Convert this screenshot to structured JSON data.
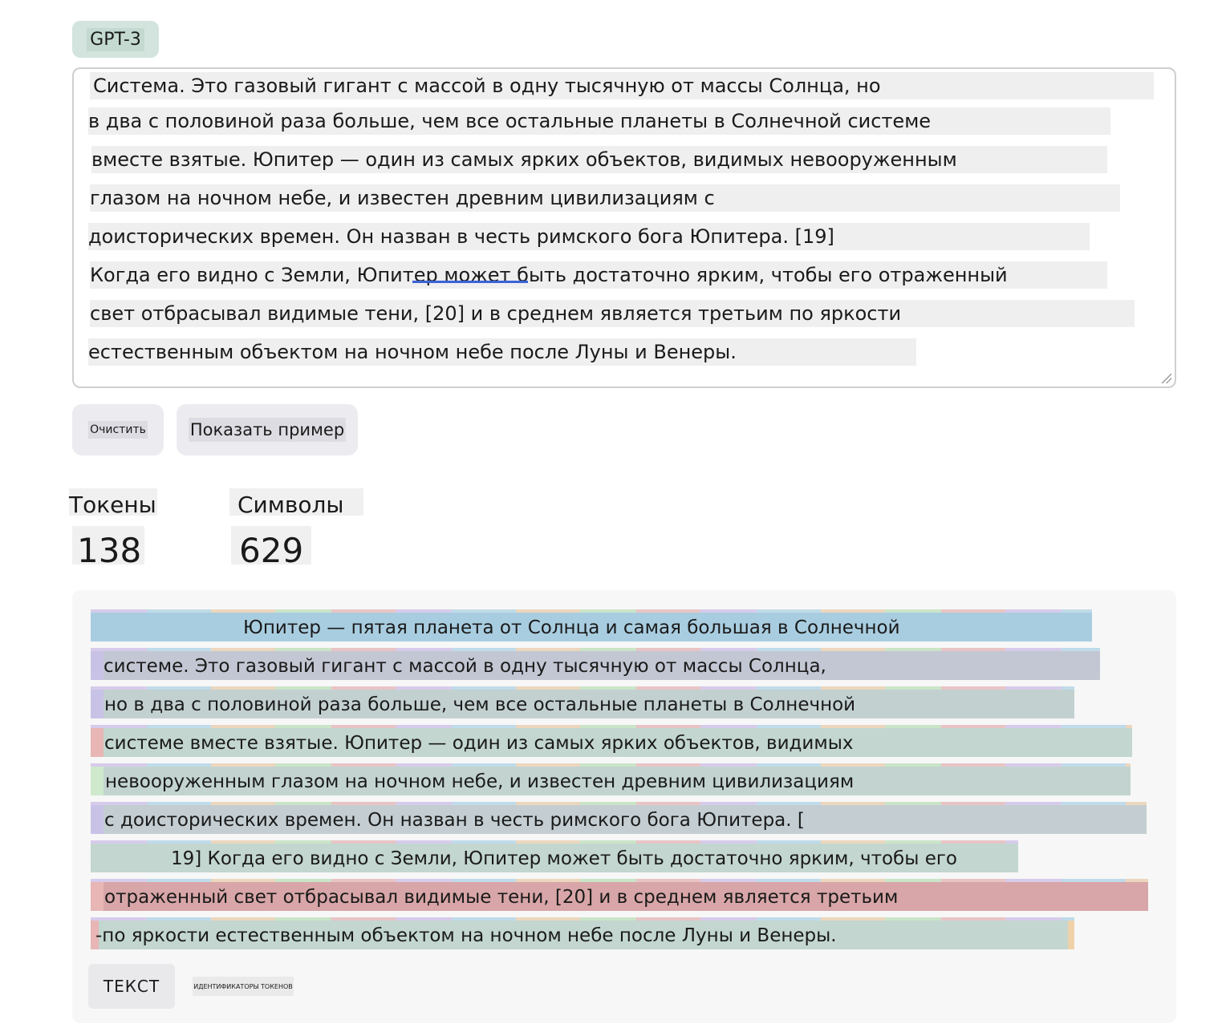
{
  "model_badge": "GPT-3",
  "editor": {
    "lines": [
      "Система. Это газовый гигант с массой в одну тысячную от массы Солнца, но",
      "в два с половиной раза больше, чем все остальные планеты в Солнечной системе",
      "вместе взятые. Юпитер — один из самых ярких объектов, видимых невооруженным",
      "глазом на ночном небе, и известен древним цивилизациям с",
      "доисторических времен. Он назван в честь римского бога Юпитера. [19]",
      "Когда его видно с Земли, Юпитер может быть достаточно ярким, чтобы его отраженный",
      "свет отбрасывал видимые тени, [20] и в среднем является третьим по яркости",
      "естественным объектом на ночном небе после Луны и Венеры."
    ]
  },
  "buttons": {
    "clear": "Очистить",
    "show_example": "Показать пример"
  },
  "stats": {
    "tokens_label": "Токены",
    "tokens_value": "138",
    "chars_label": "Символы",
    "chars_value": "629"
  },
  "tokenized": {
    "lines": [
      "Юпитер — пятая планета от Солнца и самая большая в Солнечной",
      "системе. Это газовый гигант с массой в одну тысячную от массы Солнца,",
      "но в два с половиной раза больше, чем все остальные планеты в Солнечной",
      "системе вместе взятые. Юпитер — один из самых ярких объектов, видимых",
      "невооруженным глазом на ночном небе, и известен древним цивилизациям",
      "с доисторических времен. Он назван в честь римского бога Юпитера. [",
      "19] Когда его видно с Земли, Юпитер может быть достаточно ярким, чтобы его",
      "отраженный свет отбрасывал видимые тени, [20] и в среднем является третьим",
      "-по яркости естественным объектом на ночном небе после Луны и Венеры."
    ],
    "colors": {
      "blue": "#a9cde0",
      "purple": "#c8c3e6",
      "green": "#c3d6d0",
      "red": "#e2aaab",
      "pink": "#e7b6b5",
      "lightgreen": "#cfe9cd",
      "orange": "#f0d2aa"
    }
  },
  "tabs": {
    "text": "ТЕКСТ",
    "token_ids": "ИДЕНТИФИКАТОРЫ ТОКЕНОВ"
  }
}
